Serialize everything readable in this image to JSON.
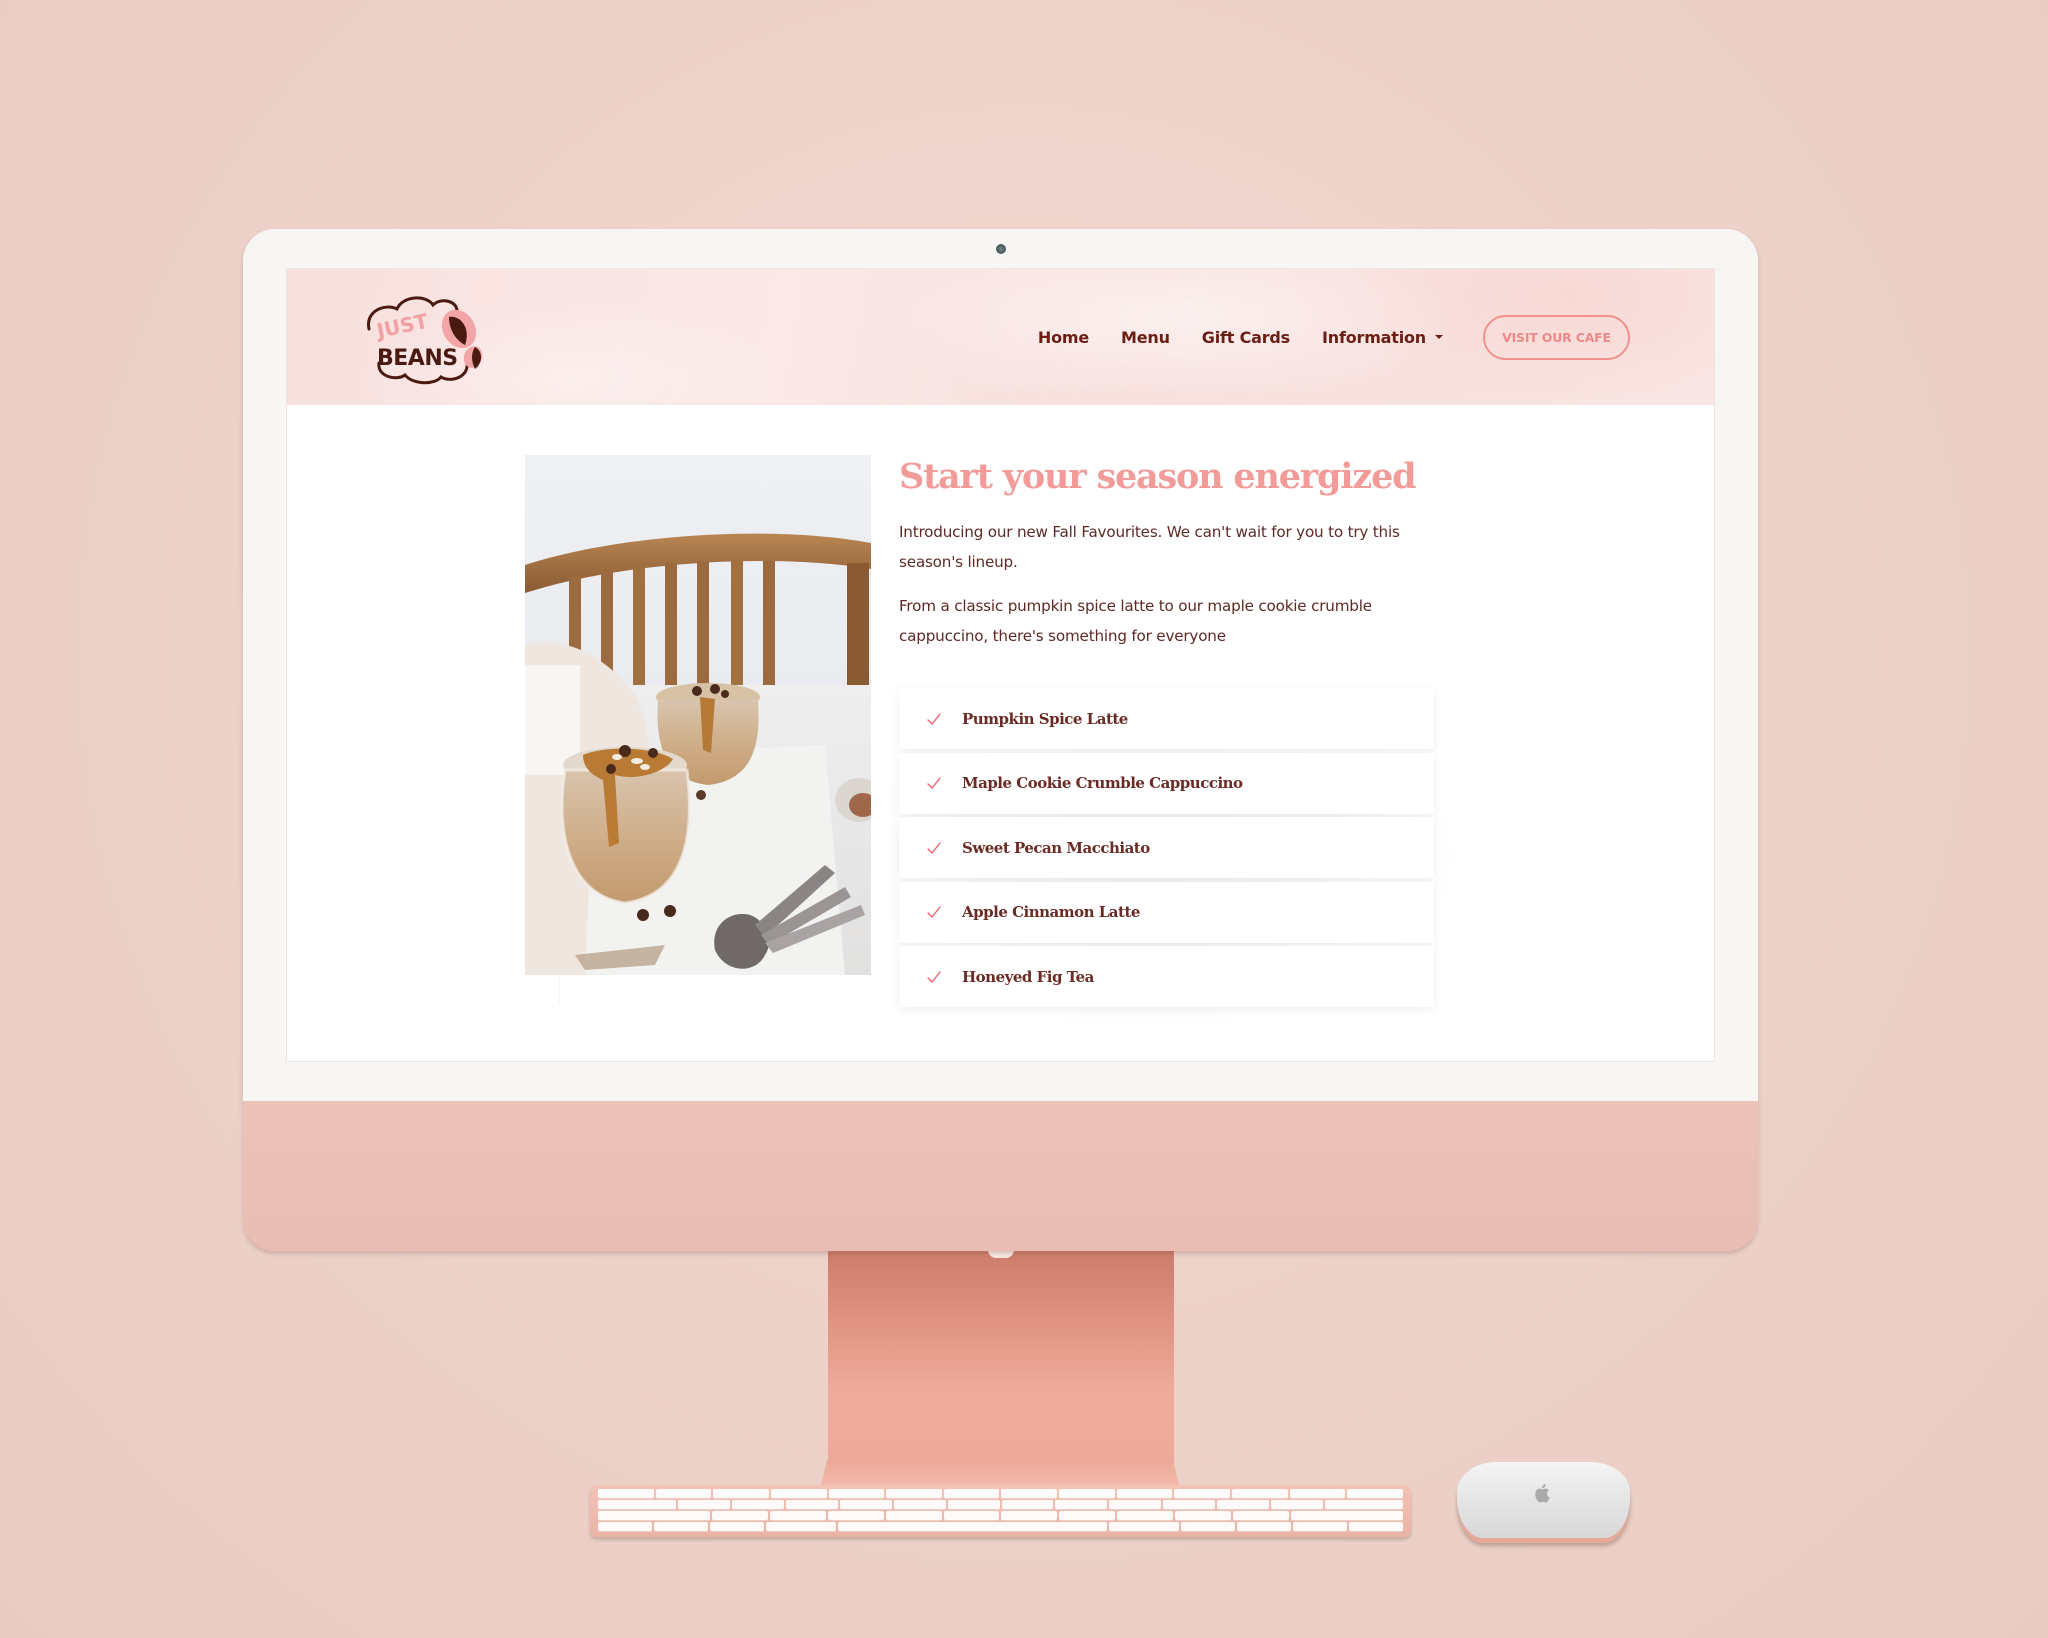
{
  "site": {
    "brand": {
      "logo_line1": "JUST",
      "logo_line2": "BEANS",
      "logo_icon": "coffee-bean-icon"
    },
    "nav": {
      "items": [
        {
          "label": "Home",
          "has_dropdown": false
        },
        {
          "label": "Menu",
          "has_dropdown": false
        },
        {
          "label": "Gift Cards",
          "has_dropdown": false
        },
        {
          "label": "Information",
          "has_dropdown": true
        }
      ],
      "cta_label": "VISIT OUR CAFE"
    },
    "hero": {
      "image_alt": "Two jars of fall latte-flavoured overnight oats topped with caramel drizzle, oats and chocolate chips, with vintage spoons",
      "title": "Start your season energized",
      "paragraphs": [
        "Introducing our new Fall Favourites. We can't wait for you to try this season's lineup.",
        "From a classic pumpkin spice latte to our maple cookie crumble cappuccino, there's something for everyone"
      ],
      "list_icon": "checkmark-icon",
      "list": [
        {
          "label": "Pumpkin Spice Latte"
        },
        {
          "label": "Maple Cookie Crumble Cappuccino"
        },
        {
          "label": "Sweet Pecan Macchiato"
        },
        {
          "label": "Apple Cinnamon Latte"
        },
        {
          "label": "Honeyed Fig Tea"
        }
      ]
    }
  },
  "colors": {
    "background": "#eed4cb",
    "accent_pink": "#f29b98",
    "brand_brown": "#6b1e14",
    "body_text": "#5e2a24",
    "check": "#e8606a",
    "header_bg": "#f8e1df",
    "device_pink": "#e9bdb3"
  },
  "device": {
    "type": "desktop monitor mockup",
    "peripherals": [
      "keyboard",
      "mouse"
    ],
    "mouse_logo": "apple-logo-icon"
  }
}
